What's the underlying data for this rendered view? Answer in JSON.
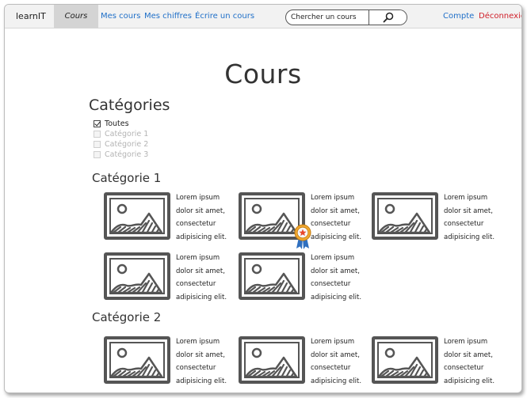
{
  "navbar": {
    "brand": "learnIT",
    "active_item": "Cours",
    "links": [
      "Mes cours",
      "Mes chiffres",
      "Écrire un cours"
    ],
    "account": "Compte",
    "logout": "Déconnexion",
    "search": {
      "placeholder": "Chercher un cours",
      "icon": "magnifier-icon"
    }
  },
  "main": {
    "title": "Cours",
    "categories_heading": "Catégories",
    "filters": [
      {
        "label": "Toutes",
        "checked": true
      },
      {
        "label": "Catégorie 1",
        "checked": false
      },
      {
        "label": "Catégorie 2",
        "checked": false
      },
      {
        "label": "Catégorie 3",
        "checked": false
      }
    ],
    "sections": [
      {
        "title": "Catégorie 1",
        "course_count": 5
      },
      {
        "title": "Catégorie 2",
        "course_count": 3
      }
    ],
    "course_text": [
      "Lorem ipsum",
      "dolor sit amet,",
      "consectetur",
      "adipisicing elit."
    ],
    "course_icon": "image-placeholder-icon",
    "badge_icon": "award-ribbon-icon"
  },
  "colors": {
    "link": "#1f6fc8",
    "logout": "#d0202a",
    "navbar_bg": "#f2f2f2",
    "active_tab_bg": "#d4d4d4",
    "sketch_stroke": "#555555"
  }
}
